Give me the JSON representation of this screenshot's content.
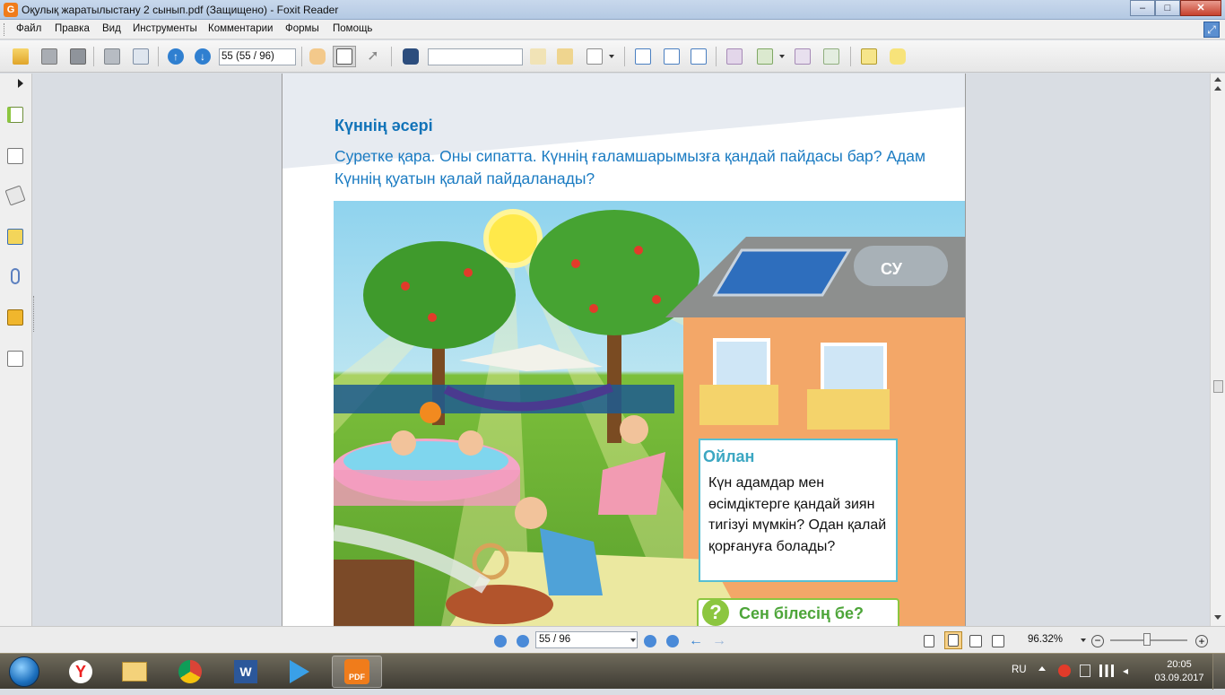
{
  "window": {
    "title": "Оқулық жаратылыстану 2 сынып.pdf (Защищено) - Foxit Reader",
    "app_logo": "G",
    "minimize": "–",
    "maximize": "□",
    "close": "✕"
  },
  "menu": {
    "items": [
      "Файл",
      "Правка",
      "Вид",
      "Инструменты",
      "Комментарии",
      "Формы",
      "Помощь"
    ]
  },
  "toolbar": {
    "page_value": "55 (55 / 96)",
    "search_value": ""
  },
  "document": {
    "heading": "Күннің әсері",
    "question": "Суретке қара. Оны сипатта. Күннің ғаламшарымызға қандай пайдасы бар? Адам Күннің қуатын қалай пайдаланады?",
    "think_title": "Ойлан",
    "think_text": "Күн адамдар мен өсімдіктерге қандай зиян тигізуі мүмкін? Одан қалай қорғануға болады?",
    "didyouknow_label": "Сен білесің бе?",
    "tank_label": "СУ"
  },
  "statusbar": {
    "page_value": "55 / 96",
    "zoom": "96.32%"
  },
  "tray": {
    "language": "RU",
    "time": "20:05",
    "date": "03.09.2017"
  },
  "colors": {
    "heading_blue": "#1173b8",
    "think_border": "#57bfd3",
    "didyouknow_green": "#8cc63f"
  }
}
